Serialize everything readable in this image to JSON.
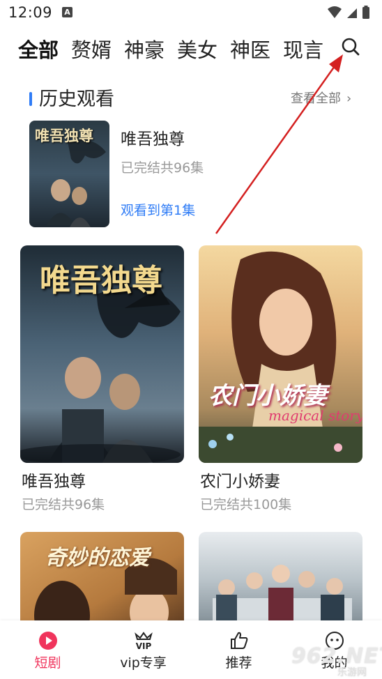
{
  "status_bar": {
    "time": "12:09",
    "notification_letter": "A"
  },
  "tabs": [
    {
      "label": "全部",
      "active": true
    },
    {
      "label": "赘婿",
      "active": false
    },
    {
      "label": "神豪",
      "active": false
    },
    {
      "label": "美女",
      "active": false
    },
    {
      "label": "神医",
      "active": false
    },
    {
      "label": "现言",
      "active": false
    }
  ],
  "history": {
    "title": "历史观看",
    "view_all": "查看全部",
    "view_all_chevron": "›",
    "item": {
      "title": "唯吾独尊",
      "status": "已完结共96集",
      "progress": "观看到第1集",
      "cover_text": "唯吾独尊"
    }
  },
  "grid": [
    {
      "title": "唯吾独尊",
      "status": "已完结共96集",
      "cover_text": "唯吾独尊"
    },
    {
      "title": "农门小娇妻",
      "status": "已完结共100集",
      "cover_text": "农门小娇妻",
      "cover_sub": "magical story"
    },
    {
      "cover_text": "奇妙的恋爱"
    },
    {
      "cover_text": ""
    }
  ],
  "bottom_nav": [
    {
      "label": "短剧",
      "icon": "play-circle-icon",
      "active": true
    },
    {
      "label": "vip专享",
      "icon": "vip-crown-icon",
      "active": false
    },
    {
      "label": "推荐",
      "icon": "thumbs-up-icon",
      "active": false
    },
    {
      "label": "我的",
      "icon": "chat-face-icon",
      "active": false
    }
  ],
  "watermark": {
    "text": "962.NET",
    "sub": "乐游网"
  },
  "colors": {
    "accent_blue": "#2f7cf6",
    "active_red": "#f0345c",
    "arrow_red": "#d42020"
  }
}
